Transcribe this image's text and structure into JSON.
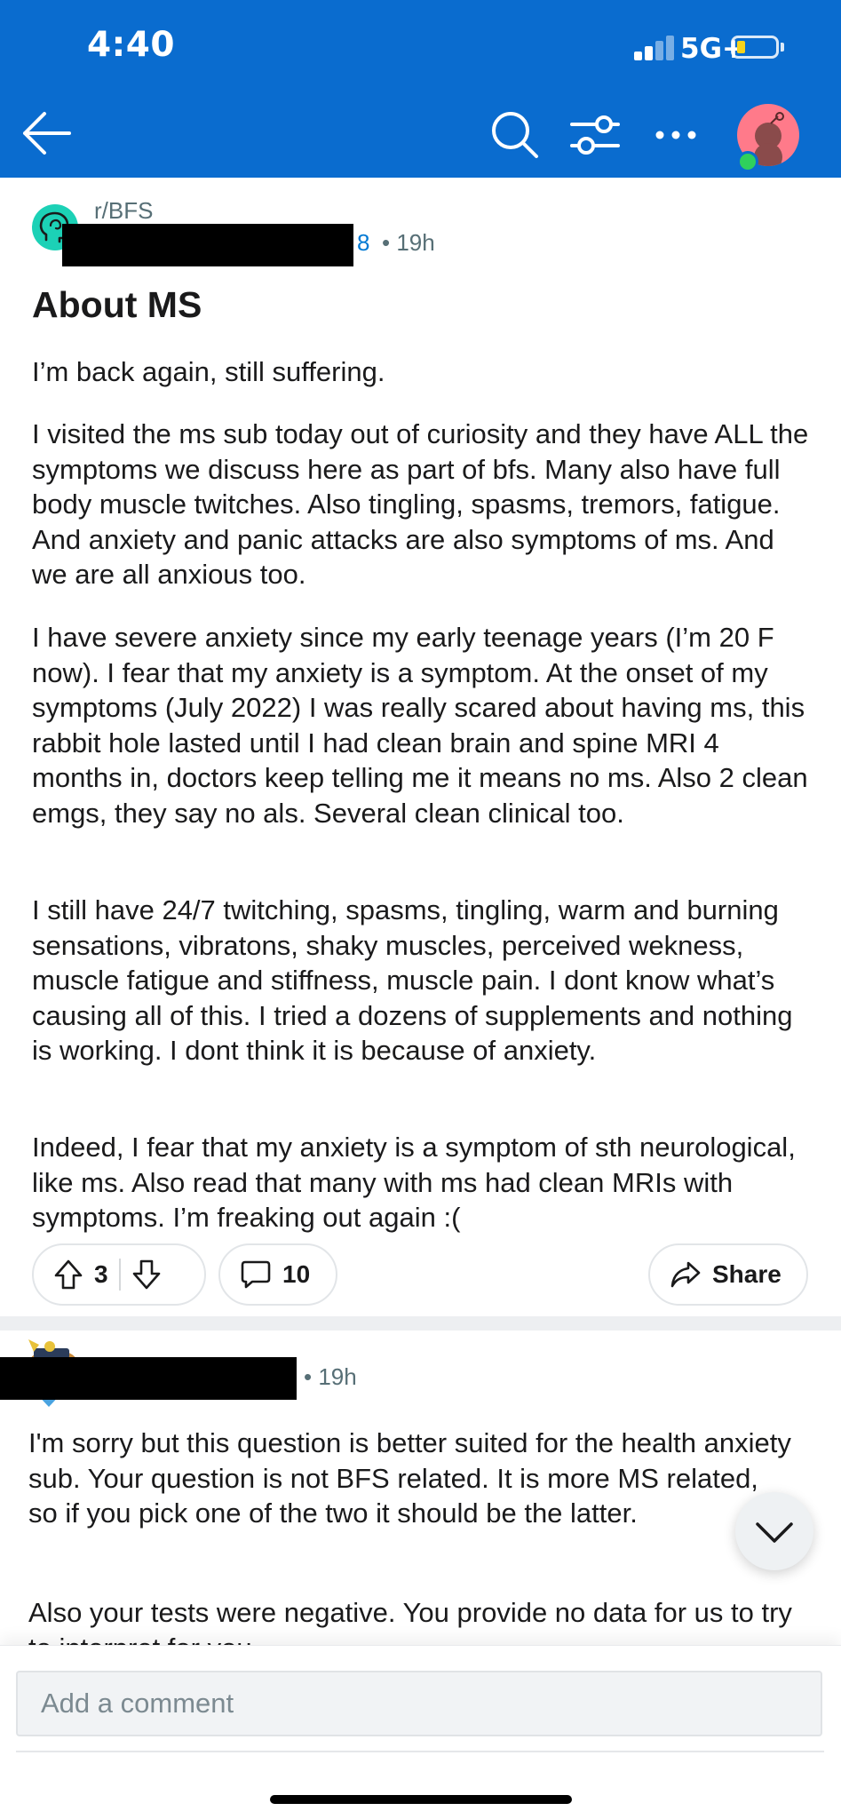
{
  "status_bar": {
    "time": "4:40",
    "network": "5G+"
  },
  "post": {
    "subreddit": "r/BFS",
    "author_visible_tail": "8",
    "time": "19h",
    "title": "About MS",
    "paragraphs": [
      "I’m back again, still suffering.",
      "I visited the ms sub today out of curiosity and they have ALL the symptoms we discuss here as part of bfs. Many also have full body muscle twitches. Also tingling, spasms, tremors, fatigue. And anxiety and panic attacks are also symptoms of ms. And we are all anxious too.",
      "I have severe anxiety since my early teenage years (I’m 20 F now). I fear that my anxiety is a symptom. At the onset of my symptoms (July 2022) I was really scared about having ms, this rabbit hole lasted until I had clean brain and spine MRI 4 months in, doctors keep telling me it means no ms. Also 2 clean emgs, they say no als. Several clean clinical too.",
      "I still have 24/7 twitching, spasms, tingling, warm and burning sensations, vibratons, shaky muscles, perceived wekness, muscle fatigue and stiffness, muscle pain. I dont know what’s causing all of this. I tried a dozens of supplements and nothing is working. I dont think it is because of anxiety.",
      "Indeed, I fear that my anxiety is a symptom of sth neurological, like ms. Also read that many with ms had clean MRIs with symptoms. I’m freaking out again :("
    ],
    "votes": "3",
    "comments": "10",
    "share_label": "Share"
  },
  "comment": {
    "time": "19h",
    "paragraphs": [
      "I'm sorry but this question is better suited for the health anxiety sub. Your question is not BFS related. It is more MS related, so if you pick one of the two it should be the latter.",
      "Also your tests were negative. You provide no data for us to try to interpret for you."
    ]
  },
  "composer": {
    "placeholder": "Add a comment"
  },
  "colors": {
    "header": "#0a6ccf",
    "subreddit_icon": "#1cd1b6",
    "avatar": "#ff7a8a"
  }
}
